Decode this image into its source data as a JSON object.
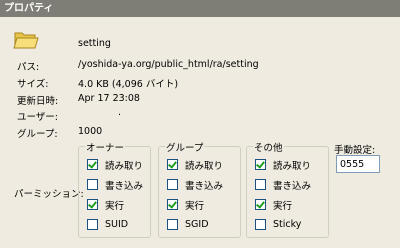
{
  "window": {
    "title": "プロパティ"
  },
  "file": {
    "icon": "folder-icon",
    "name": "setting"
  },
  "properties": [
    {
      "label": "パス:",
      "value": "/yoshida-ya.org/public_html/ra/setting"
    },
    {
      "label": "サイズ:",
      "value": "4.0 KB (4,096 バイト)"
    },
    {
      "label": "更新日時:",
      "value": "Apr 17 23:08"
    },
    {
      "label": "ユーザー:",
      "value": "."
    },
    {
      "label": "グループ:",
      "value": "1000"
    }
  ],
  "permissions": {
    "label": "パーミッション:",
    "groups": [
      {
        "title": "オーナー",
        "items": [
          {
            "label": "読み取り",
            "checked": true
          },
          {
            "label": "書き込み",
            "checked": false
          },
          {
            "label": "実行",
            "checked": true
          },
          {
            "label": "SUID",
            "checked": false
          }
        ]
      },
      {
        "title": "グループ",
        "items": [
          {
            "label": "読み取り",
            "checked": true
          },
          {
            "label": "書き込み",
            "checked": false
          },
          {
            "label": "実行",
            "checked": true
          },
          {
            "label": "SGID",
            "checked": false
          }
        ]
      },
      {
        "title": "その他",
        "items": [
          {
            "label": "読み取り",
            "checked": true
          },
          {
            "label": "書き込み",
            "checked": false
          },
          {
            "label": "実行",
            "checked": true
          },
          {
            "label": "Sticky",
            "checked": false
          }
        ]
      }
    ]
  },
  "manual": {
    "label": "手動設定:",
    "value": "0555"
  },
  "colors": {
    "titlebar": "#7e7e76",
    "background": "#efebe0",
    "check": "#21a121"
  }
}
